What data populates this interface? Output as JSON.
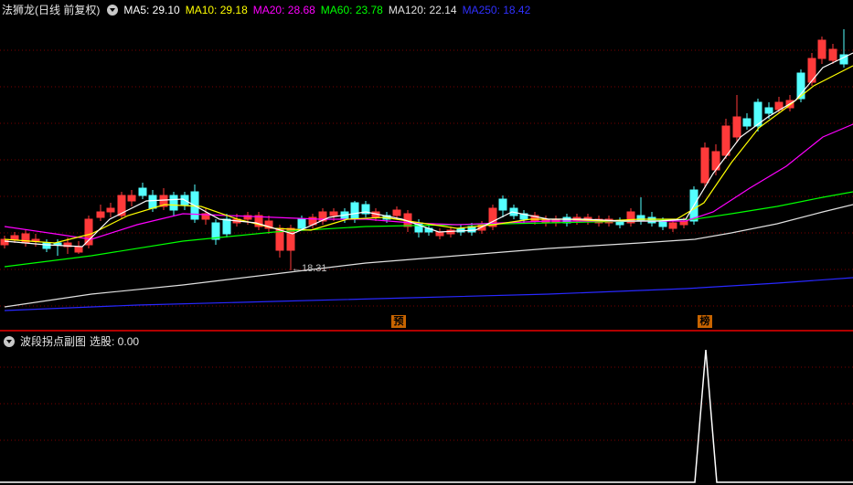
{
  "main": {
    "title": "法狮龙(日线 前复权)",
    "ma_labels": [
      {
        "text": "MA5: 29.10",
        "color": "#ffffff"
      },
      {
        "text": "MA10: 29.18",
        "color": "#ffff00"
      },
      {
        "text": "MA20: 28.68",
        "color": "#ff00ff"
      },
      {
        "text": "MA60: 23.78",
        "color": "#00ff00"
      },
      {
        "text": "MA120: 22.14",
        "color": "#e0e0e0"
      },
      {
        "text": "MA250: 18.42",
        "color": "#3030ff"
      }
    ],
    "low_label": "18.31",
    "tags": [
      "预",
      "榜"
    ]
  },
  "sub": {
    "title": "波段拐点副图",
    "value_text": "选股: 0.00"
  },
  "colors": {
    "up": "#ff3a3a",
    "down": "#54ffff",
    "grid": "#7a0000",
    "border": "#b00000"
  }
}
